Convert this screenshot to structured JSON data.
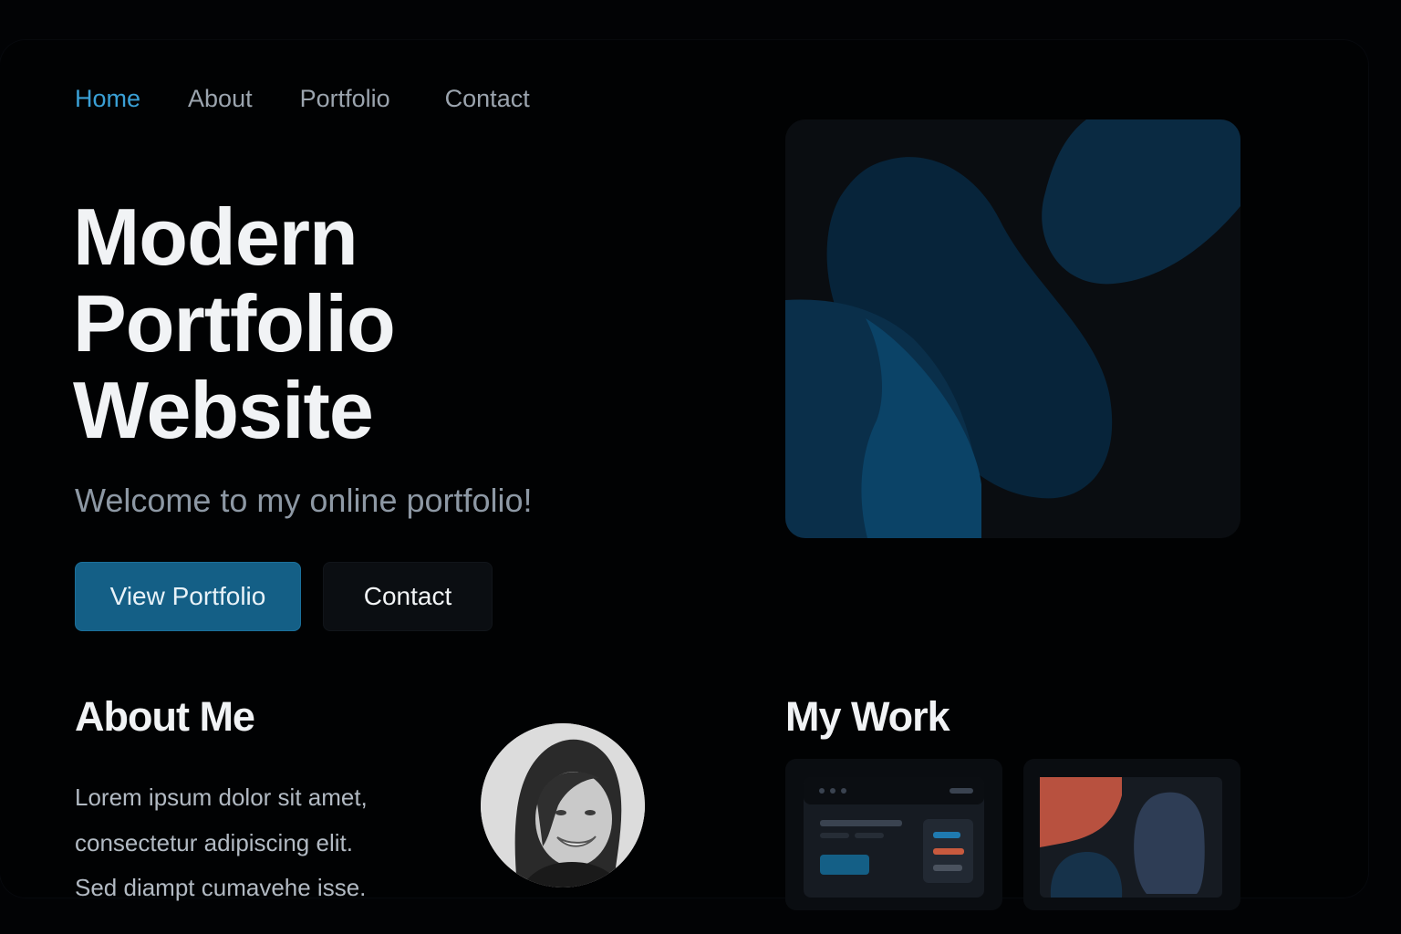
{
  "nav": {
    "items": [
      {
        "label": "Home",
        "active": true
      },
      {
        "label": "About",
        "active": false
      },
      {
        "label": "Portfolio",
        "active": false
      },
      {
        "label": "Contact",
        "active": false
      }
    ]
  },
  "hero": {
    "title_lines": [
      "Modern",
      "Portfolio",
      "Website"
    ],
    "subtitle": "Welcome to my online portfolio!",
    "primary_button": "View Portfolio",
    "secondary_button": "Contact"
  },
  "about": {
    "title": "About Me",
    "text_lines": [
      "Lorem ipsum dolor sit amet,",
      "consectetur adipiscing elit.",
      "Sed diampt cumavehe isse."
    ]
  },
  "work": {
    "title": "My Work"
  },
  "colors": {
    "accent": "#3aa0d6",
    "primary_button": "#145f86",
    "background": "#010203",
    "blob_blue": "#0b3d5e",
    "orange": "#b8513f"
  },
  "icons": {
    "avatar": "profile-photo",
    "hero_art": "abstract-shapes"
  }
}
